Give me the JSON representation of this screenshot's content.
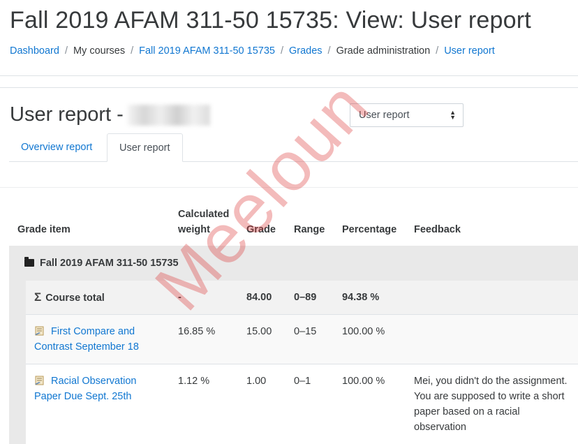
{
  "page": {
    "title": "Fall 2019 AFAM 311-50 15735: View: User report"
  },
  "breadcrumb": {
    "items": [
      {
        "label": "Dashboard"
      },
      {
        "label": "My courses"
      },
      {
        "label": "Fall 2019 AFAM 311-50 15735"
      },
      {
        "label": "Grades"
      },
      {
        "label": "Grade administration"
      },
      {
        "label": "User report"
      }
    ],
    "separator": "/"
  },
  "report": {
    "heading": "User report -",
    "selector_value": "User report"
  },
  "tabs": [
    {
      "label": "Overview report"
    },
    {
      "label": "User report"
    }
  ],
  "table": {
    "headers": {
      "grade_item": "Grade item",
      "weight": "Calculated weight",
      "grade": "Grade",
      "range": "Range",
      "percentage": "Percentage",
      "feedback": "Feedback"
    },
    "category": "Fall 2019 AFAM 311-50 15735",
    "total": {
      "label": "Course total",
      "weight": "-",
      "grade": "84.00",
      "range": "0–89",
      "percentage": "94.38 %"
    },
    "items": [
      {
        "name": "First Compare and Contrast September 18",
        "weight": "16.85 %",
        "grade": "15.00",
        "range": "0–15",
        "percentage": "100.00 %",
        "feedback": ""
      },
      {
        "name": "Racial Observation Paper Due Sept. 25th",
        "weight": "1.12 %",
        "grade": "1.00",
        "range": "0–1",
        "percentage": "100.00 %",
        "feedback": "Mei, you didn't do the assignment. You are supposed to write a short paper based on a racial observation"
      }
    ]
  },
  "watermark": "Meeloun",
  "colors": {
    "link": "#1177d1",
    "text": "#373a3c",
    "category_bg": "#e9e9e9",
    "watermark": "#dc3c3c"
  }
}
